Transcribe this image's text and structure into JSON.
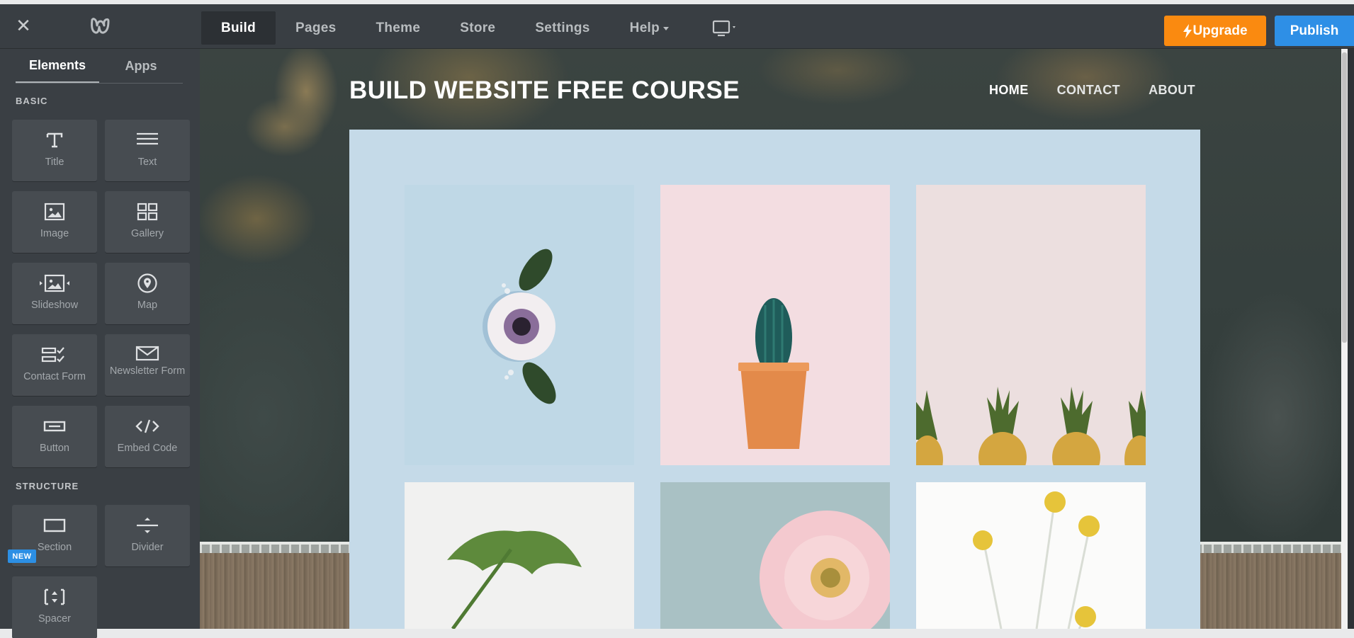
{
  "topbar": {
    "nav": [
      {
        "label": "Build",
        "active": true
      },
      {
        "label": "Pages",
        "active": false
      },
      {
        "label": "Theme",
        "active": false
      },
      {
        "label": "Store",
        "active": false
      },
      {
        "label": "Settings",
        "active": false
      },
      {
        "label": "Help",
        "active": false,
        "dropdown": true
      }
    ],
    "upgrade_label": "Upgrade",
    "publish_label": "Publish",
    "colors": {
      "upgrade": "#fa8a10",
      "publish": "#2e8fe6"
    }
  },
  "sidebar": {
    "tabs": [
      {
        "label": "Elements",
        "active": true
      },
      {
        "label": "Apps",
        "active": false
      }
    ],
    "basic_label": "BASIC",
    "structure_label": "STRUCTURE",
    "new_badge": "NEW",
    "basic_elements": [
      {
        "label": "Title",
        "icon": "title-icon"
      },
      {
        "label": "Text",
        "icon": "text-icon"
      },
      {
        "label": "Image",
        "icon": "image-icon"
      },
      {
        "label": "Gallery",
        "icon": "gallery-icon"
      },
      {
        "label": "Slideshow",
        "icon": "slideshow-icon"
      },
      {
        "label": "Map",
        "icon": "map-pin-icon"
      },
      {
        "label": "Contact Form",
        "icon": "contact-form-icon"
      },
      {
        "label": "Newsletter Form",
        "icon": "envelope-icon"
      },
      {
        "label": "Button",
        "icon": "button-icon"
      },
      {
        "label": "Embed Code",
        "icon": "code-icon"
      }
    ],
    "structure_elements": [
      {
        "label": "Section",
        "icon": "section-icon"
      },
      {
        "label": "Divider",
        "icon": "divider-icon"
      },
      {
        "label": "Spacer",
        "icon": "spacer-icon"
      }
    ]
  },
  "site": {
    "title": "BUILD WEBSITE FREE COURSE",
    "nav": [
      {
        "label": "HOME",
        "current": true
      },
      {
        "label": "CONTACT",
        "current": false
      },
      {
        "label": "ABOUT",
        "current": false
      }
    ],
    "content_bg": "#c5dae8"
  }
}
